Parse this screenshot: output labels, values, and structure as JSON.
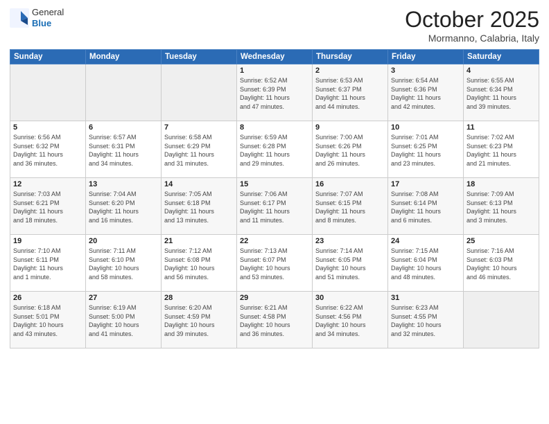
{
  "header": {
    "logo_general": "General",
    "logo_blue": "Blue",
    "month_title": "October 2025",
    "location": "Mormanno, Calabria, Italy"
  },
  "days_of_week": [
    "Sunday",
    "Monday",
    "Tuesday",
    "Wednesday",
    "Thursday",
    "Friday",
    "Saturday"
  ],
  "weeks": [
    [
      {
        "day": "",
        "info": ""
      },
      {
        "day": "",
        "info": ""
      },
      {
        "day": "",
        "info": ""
      },
      {
        "day": "1",
        "info": "Sunrise: 6:52 AM\nSunset: 6:39 PM\nDaylight: 11 hours\nand 47 minutes."
      },
      {
        "day": "2",
        "info": "Sunrise: 6:53 AM\nSunset: 6:37 PM\nDaylight: 11 hours\nand 44 minutes."
      },
      {
        "day": "3",
        "info": "Sunrise: 6:54 AM\nSunset: 6:36 PM\nDaylight: 11 hours\nand 42 minutes."
      },
      {
        "day": "4",
        "info": "Sunrise: 6:55 AM\nSunset: 6:34 PM\nDaylight: 11 hours\nand 39 minutes."
      }
    ],
    [
      {
        "day": "5",
        "info": "Sunrise: 6:56 AM\nSunset: 6:32 PM\nDaylight: 11 hours\nand 36 minutes."
      },
      {
        "day": "6",
        "info": "Sunrise: 6:57 AM\nSunset: 6:31 PM\nDaylight: 11 hours\nand 34 minutes."
      },
      {
        "day": "7",
        "info": "Sunrise: 6:58 AM\nSunset: 6:29 PM\nDaylight: 11 hours\nand 31 minutes."
      },
      {
        "day": "8",
        "info": "Sunrise: 6:59 AM\nSunset: 6:28 PM\nDaylight: 11 hours\nand 29 minutes."
      },
      {
        "day": "9",
        "info": "Sunrise: 7:00 AM\nSunset: 6:26 PM\nDaylight: 11 hours\nand 26 minutes."
      },
      {
        "day": "10",
        "info": "Sunrise: 7:01 AM\nSunset: 6:25 PM\nDaylight: 11 hours\nand 23 minutes."
      },
      {
        "day": "11",
        "info": "Sunrise: 7:02 AM\nSunset: 6:23 PM\nDaylight: 11 hours\nand 21 minutes."
      }
    ],
    [
      {
        "day": "12",
        "info": "Sunrise: 7:03 AM\nSunset: 6:21 PM\nDaylight: 11 hours\nand 18 minutes."
      },
      {
        "day": "13",
        "info": "Sunrise: 7:04 AM\nSunset: 6:20 PM\nDaylight: 11 hours\nand 16 minutes."
      },
      {
        "day": "14",
        "info": "Sunrise: 7:05 AM\nSunset: 6:18 PM\nDaylight: 11 hours\nand 13 minutes."
      },
      {
        "day": "15",
        "info": "Sunrise: 7:06 AM\nSunset: 6:17 PM\nDaylight: 11 hours\nand 11 minutes."
      },
      {
        "day": "16",
        "info": "Sunrise: 7:07 AM\nSunset: 6:15 PM\nDaylight: 11 hours\nand 8 minutes."
      },
      {
        "day": "17",
        "info": "Sunrise: 7:08 AM\nSunset: 6:14 PM\nDaylight: 11 hours\nand 6 minutes."
      },
      {
        "day": "18",
        "info": "Sunrise: 7:09 AM\nSunset: 6:13 PM\nDaylight: 11 hours\nand 3 minutes."
      }
    ],
    [
      {
        "day": "19",
        "info": "Sunrise: 7:10 AM\nSunset: 6:11 PM\nDaylight: 11 hours\nand 1 minute."
      },
      {
        "day": "20",
        "info": "Sunrise: 7:11 AM\nSunset: 6:10 PM\nDaylight: 10 hours\nand 58 minutes."
      },
      {
        "day": "21",
        "info": "Sunrise: 7:12 AM\nSunset: 6:08 PM\nDaylight: 10 hours\nand 56 minutes."
      },
      {
        "day": "22",
        "info": "Sunrise: 7:13 AM\nSunset: 6:07 PM\nDaylight: 10 hours\nand 53 minutes."
      },
      {
        "day": "23",
        "info": "Sunrise: 7:14 AM\nSunset: 6:05 PM\nDaylight: 10 hours\nand 51 minutes."
      },
      {
        "day": "24",
        "info": "Sunrise: 7:15 AM\nSunset: 6:04 PM\nDaylight: 10 hours\nand 48 minutes."
      },
      {
        "day": "25",
        "info": "Sunrise: 7:16 AM\nSunset: 6:03 PM\nDaylight: 10 hours\nand 46 minutes."
      }
    ],
    [
      {
        "day": "26",
        "info": "Sunrise: 6:18 AM\nSunset: 5:01 PM\nDaylight: 10 hours\nand 43 minutes."
      },
      {
        "day": "27",
        "info": "Sunrise: 6:19 AM\nSunset: 5:00 PM\nDaylight: 10 hours\nand 41 minutes."
      },
      {
        "day": "28",
        "info": "Sunrise: 6:20 AM\nSunset: 4:59 PM\nDaylight: 10 hours\nand 39 minutes."
      },
      {
        "day": "29",
        "info": "Sunrise: 6:21 AM\nSunset: 4:58 PM\nDaylight: 10 hours\nand 36 minutes."
      },
      {
        "day": "30",
        "info": "Sunrise: 6:22 AM\nSunset: 4:56 PM\nDaylight: 10 hours\nand 34 minutes."
      },
      {
        "day": "31",
        "info": "Sunrise: 6:23 AM\nSunset: 4:55 PM\nDaylight: 10 hours\nand 32 minutes."
      },
      {
        "day": "",
        "info": ""
      }
    ]
  ]
}
